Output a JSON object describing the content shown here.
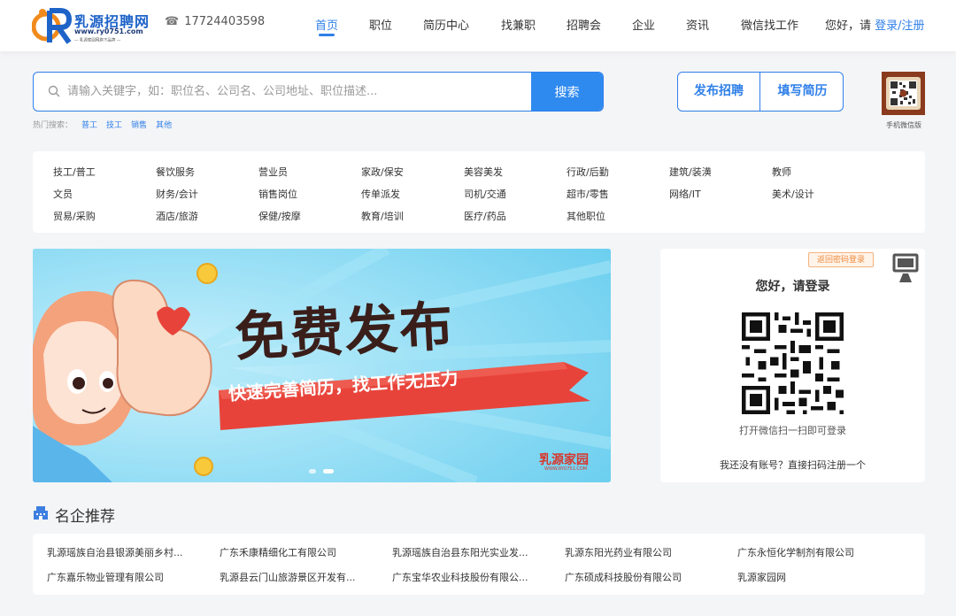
{
  "header": {
    "logo_title": "乳源招聘网",
    "logo_url": "www.ry0751.com",
    "logo_slogan": "— 乳源家园网旗下品牌 —",
    "phone": "17724403598",
    "nav": [
      {
        "label": "首页",
        "active": true
      },
      {
        "label": "职位",
        "active": false
      },
      {
        "label": "简历中心",
        "active": false
      },
      {
        "label": "找兼职",
        "active": false
      },
      {
        "label": "招聘会",
        "active": false
      },
      {
        "label": "企业",
        "active": false
      },
      {
        "label": "资讯",
        "active": false
      },
      {
        "label": "微信找工作",
        "active": false
      }
    ],
    "greeting": "您好，请",
    "login_link": "登录/注册"
  },
  "search": {
    "placeholder": "请输入关键字，如：职位名、公司名、公司地址、职位描述...",
    "button": "搜索",
    "hot_label": "热门搜索：",
    "hot_keywords": [
      "普工",
      "技工",
      "销售",
      "其他"
    ]
  },
  "actions": {
    "post_job": "发布招聘",
    "fill_resume": "填写简历"
  },
  "mobile_qr_label": "手机微信版",
  "categories": [
    [
      "技工/普工",
      "餐饮服务",
      "营业员",
      "家政/保安",
      "美容美发",
      "行政/后勤",
      "建筑/装潢",
      "教师"
    ],
    [
      "文员",
      "财务/会计",
      "销售岗位",
      "传单派发",
      "司机/交通",
      "超市/零售",
      "网络/IT",
      "美术/设计"
    ],
    [
      "贸易/采购",
      "酒店/旅游",
      "保健/按摩",
      "教育/培训",
      "医疗/药品",
      "其他职位"
    ]
  ],
  "banner": {
    "title": "免费发布",
    "subtitle": "快速完善简历，找工作无压力",
    "brand": "乳源家园",
    "brand_url": "WWW.RY0751.COM"
  },
  "login_panel": {
    "password_tip": "返回密码登录",
    "title": "您好，请登录",
    "scan_text": "打开微信扫一扫即可登录",
    "register_text": "我还没有账号？直接扫码注册一个"
  },
  "companies": {
    "title": "名企推荐",
    "items": [
      "乳源瑶族自治县银源美丽乡村...",
      "广东禾康精细化工有限公司",
      "乳源瑶族自治县东阳光实业发...",
      "乳源东阳光药业有限公司",
      "广东永恒化学制剂有限公司",
      "广东嘉乐物业管理有限公司",
      "乳源县云门山旅游景区开发有...",
      "广东宝华农业科技股份有限公...",
      "广东硕成科技股份有限公司",
      "乳源家园网"
    ]
  },
  "colors": {
    "accent": "#2f7fe9",
    "banner_bg": "#7fd8f5",
    "ribbon": "#e8433a"
  }
}
